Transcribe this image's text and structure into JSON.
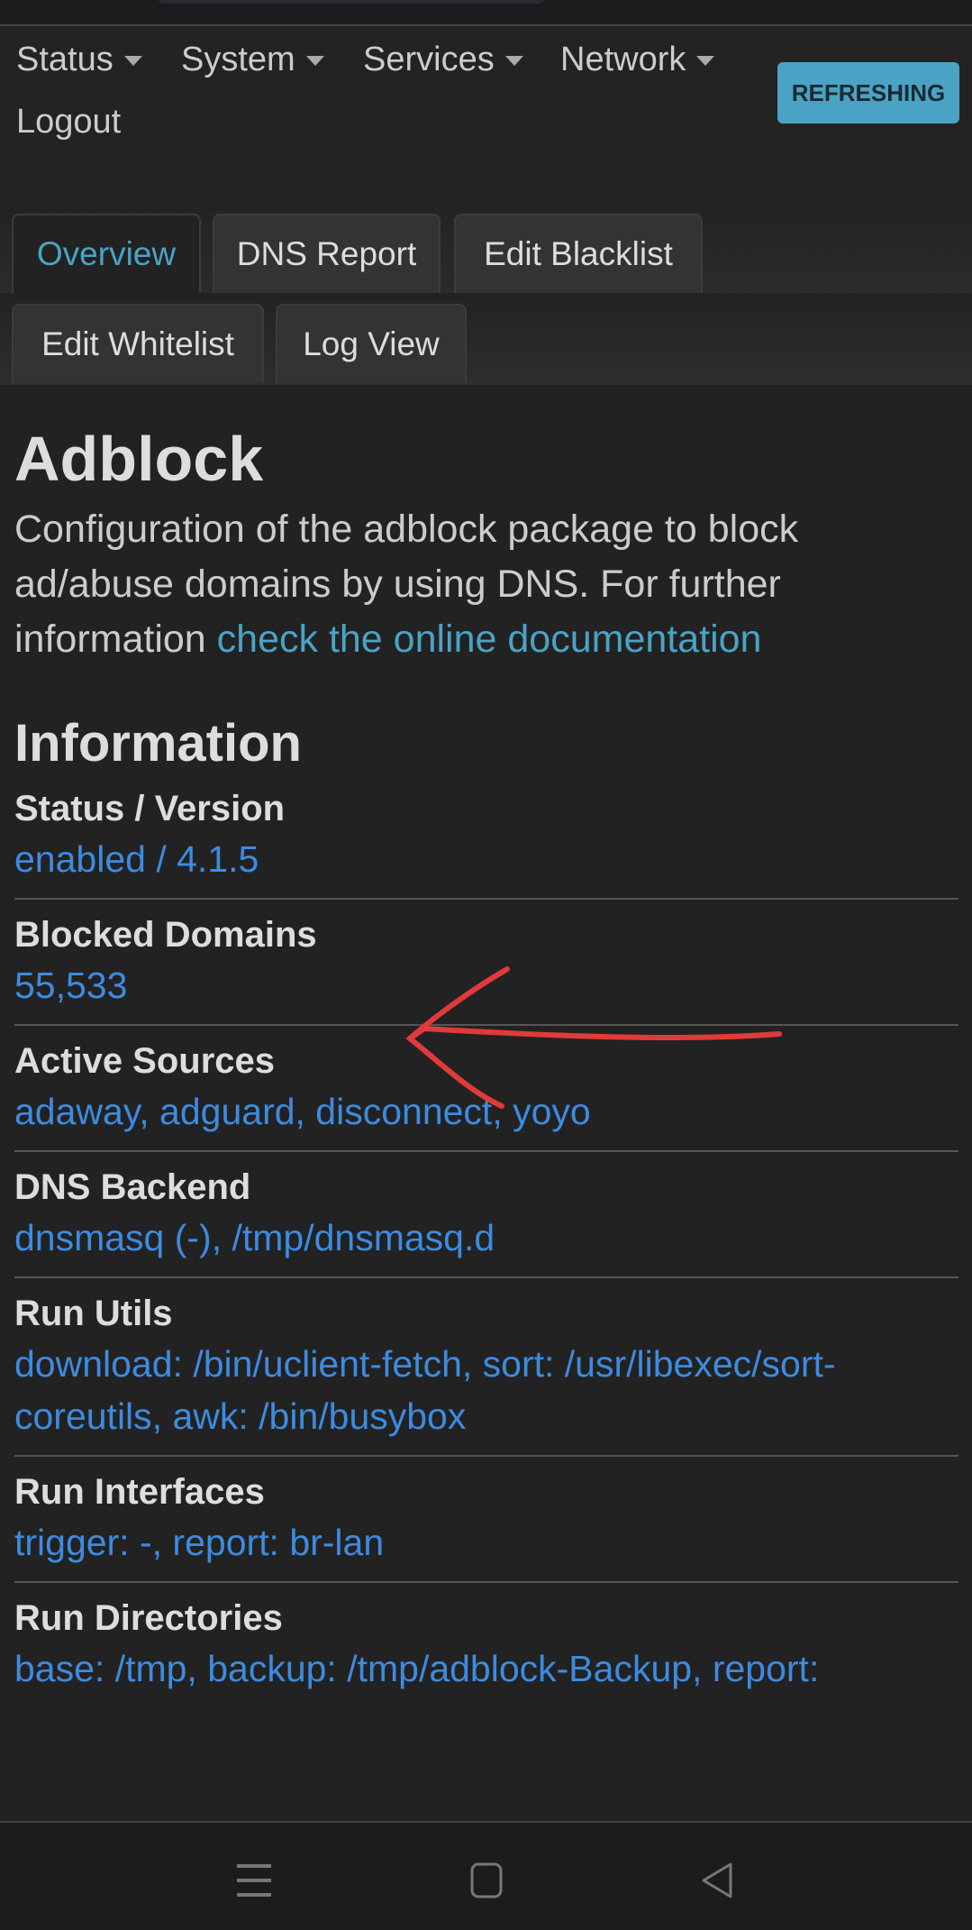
{
  "nav": {
    "items": [
      {
        "label": "Status"
      },
      {
        "label": "System"
      },
      {
        "label": "Services"
      },
      {
        "label": "Network"
      }
    ],
    "logout": "Logout",
    "refresh": "REFRESHING"
  },
  "tabs": [
    {
      "label": "Overview",
      "active": true
    },
    {
      "label": "DNS Report"
    },
    {
      "label": "Edit Blacklist"
    },
    {
      "label": "Edit Whitelist"
    },
    {
      "label": "Log View"
    }
  ],
  "page": {
    "title": "Adblock",
    "desc": "Configuration of the adblock package to block ad/abuse domains by using DNS. For further information ",
    "doc_link": "check the online documentation",
    "section": "Information"
  },
  "info": [
    {
      "label": "Status / Version",
      "value": "enabled / 4.1.5"
    },
    {
      "label": "Blocked Domains",
      "value": "55,533"
    },
    {
      "label": "Active Sources",
      "value": "adaway, adguard, disconnect, yoyo"
    },
    {
      "label": "DNS Backend",
      "value": "dnsmasq (-), /tmp/dnsmasq.d"
    },
    {
      "label": "Run Utils",
      "value": "download: /bin/uclient-fetch, sort: /usr/libexec/sort-coreutils, awk: /bin/busybox"
    },
    {
      "label": "Run Interfaces",
      "value": "trigger: -, report: br-lan"
    },
    {
      "label": "Run Directories",
      "value": "base: /tmp, backup: /tmp/adblock-Backup, report:"
    }
  ],
  "colors": {
    "accent": "#4aa3c5",
    "link": "#3d8be0",
    "annotation": "#e03a3a"
  },
  "system_nav": {
    "icons": [
      "recents-icon",
      "home-icon",
      "back-icon"
    ]
  }
}
